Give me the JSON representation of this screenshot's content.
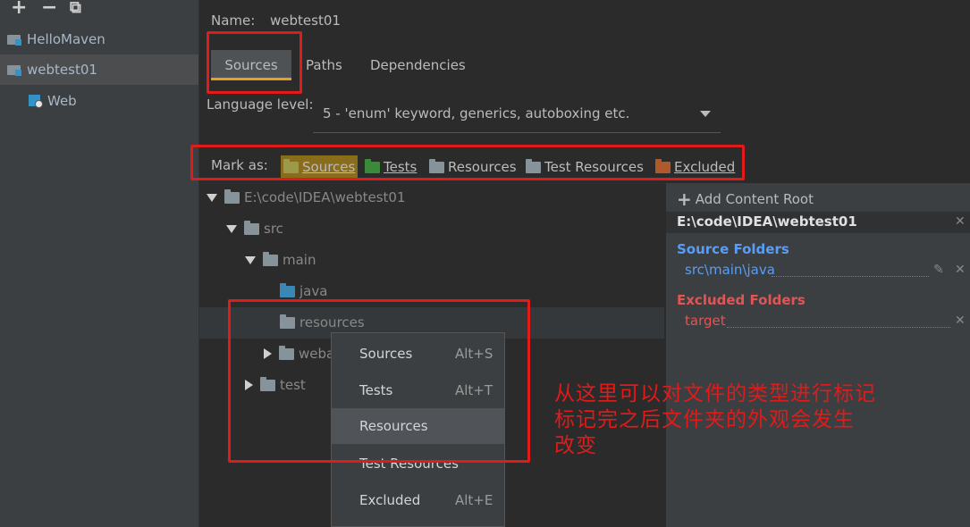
{
  "toolbar": {
    "add": "+",
    "remove": "−",
    "copy": "⧉"
  },
  "modules": [
    {
      "name": "HelloMaven"
    },
    {
      "name": "webtest01"
    },
    {
      "name": "Web"
    }
  ],
  "name_field": {
    "label": "Name:",
    "value": "webtest01"
  },
  "tabs": [
    {
      "label": "Sources"
    },
    {
      "label": "Paths"
    },
    {
      "label": "Dependencies"
    }
  ],
  "language_level": {
    "label": "Language level:",
    "value": "5 - 'enum' keyword, generics, autoboxing etc."
  },
  "mark_as": {
    "label": "Mark as:",
    "buttons": [
      {
        "label": "Sources",
        "color": "#6f8a3a"
      },
      {
        "label": "Tests",
        "color": "#3b8a3a"
      },
      {
        "label": "Resources",
        "color": "#87939a"
      },
      {
        "label": "Test Resources",
        "color": "#87939a"
      },
      {
        "label": "Excluded",
        "color": "#b0592a"
      }
    ]
  },
  "tree": {
    "root": "E:\\code\\IDEA\\webtest01",
    "src": "src",
    "main": "main",
    "java": "java",
    "resources": "resources",
    "webapp": "webapp",
    "test": "test"
  },
  "content_root": {
    "add_label": "Add Content Root",
    "path": "E:\\code\\IDEA\\webtest01",
    "source_folders_title": "Source Folders",
    "source_folder": "src\\main\\java",
    "excluded_folders_title": "Excluded Folders",
    "excluded_folder": "target"
  },
  "context_menu": [
    {
      "label": "Sources",
      "shortcut": "Alt+S"
    },
    {
      "label": "Tests",
      "shortcut": "Alt+T"
    },
    {
      "label": "Resources",
      "shortcut": ""
    },
    {
      "label": "Test Resources",
      "shortcut": ""
    },
    {
      "label": "Excluded",
      "shortcut": "Alt+E"
    }
  ],
  "annotation": {
    "line1": "从这里可以对文件的类型进行标记",
    "line2": "标记完之后文件夹的外观会发生",
    "line3": "改变"
  },
  "colors": {
    "accent": "#e6a020",
    "annotation_red": "#e11a1a",
    "source_blue": "#589df6",
    "excluded_red": "#e05555"
  }
}
